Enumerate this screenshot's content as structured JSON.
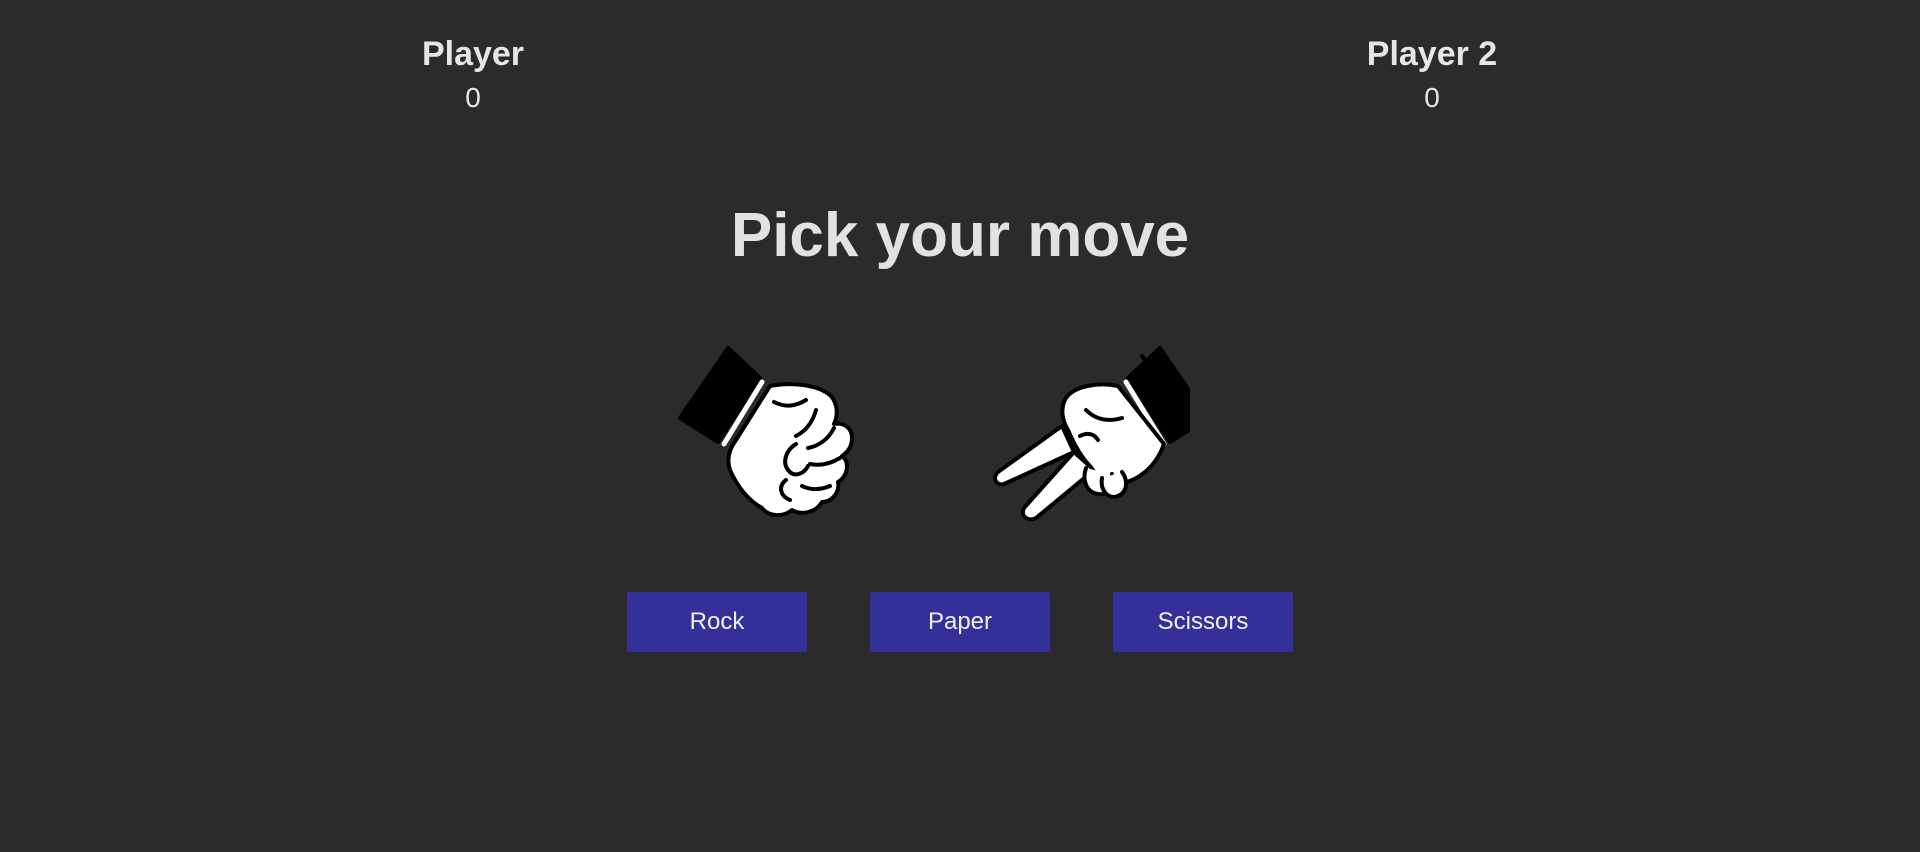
{
  "scoreboard": {
    "player1": {
      "name": "Player",
      "score": "0"
    },
    "player2": {
      "name": "Player 2",
      "score": "0"
    }
  },
  "prompt": "Pick your move",
  "hands": {
    "left": "rock-fist-icon",
    "right": "scissors-hand-icon"
  },
  "buttons": {
    "rock": "Rock",
    "paper": "Paper",
    "scissors": "Scissors"
  },
  "colors": {
    "background": "#2b2b2b",
    "text": "#e2e2e2",
    "button": "#33309a"
  }
}
